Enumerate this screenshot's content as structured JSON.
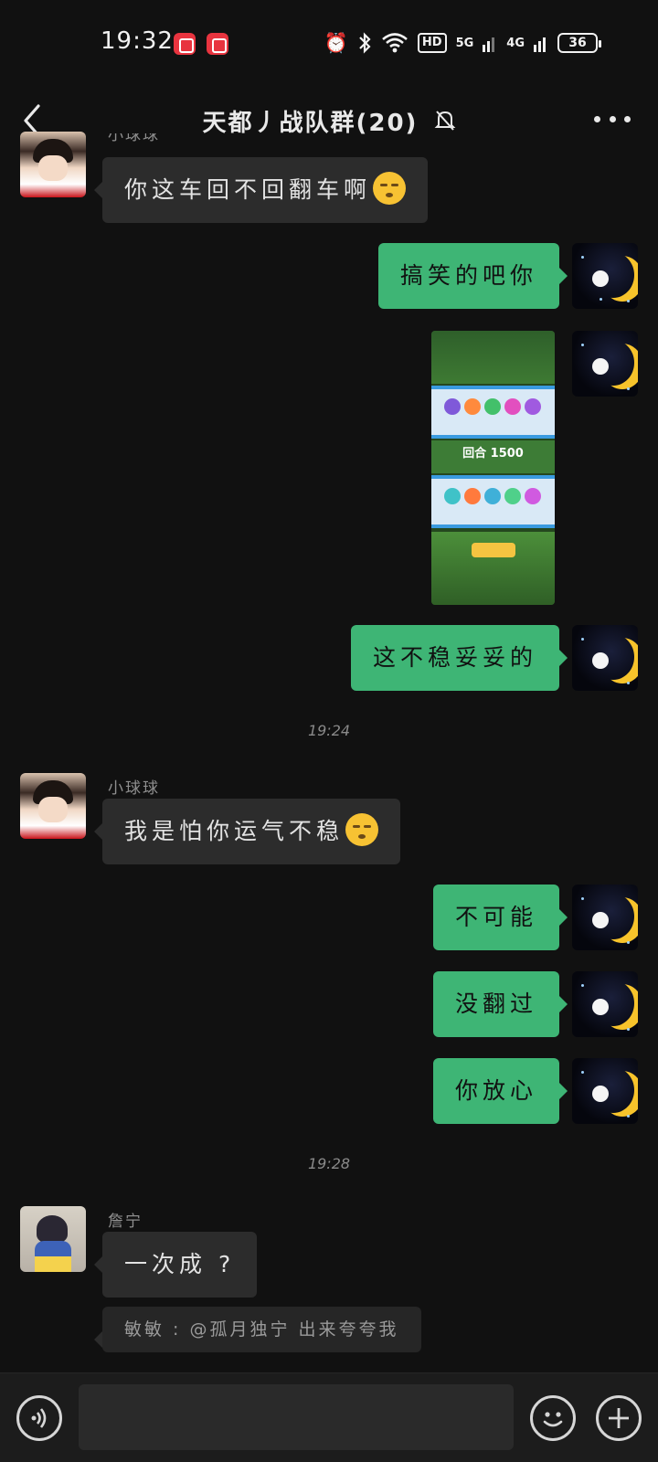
{
  "status_bar": {
    "time": "19:32",
    "network_1": "5G",
    "network_2": "4G",
    "hd": "HD",
    "battery": "36",
    "icons": [
      "app-notification-icon",
      "screen-record-icon",
      "alarm-icon",
      "bluetooth-icon",
      "wifi-icon"
    ]
  },
  "header": {
    "title": "天都丿战队群(20)",
    "icons": [
      "back-icon",
      "mute-bell-icon",
      "more-icon"
    ]
  },
  "messages": [
    {
      "sender": "小球球",
      "text": "你这车回不回翻车啊",
      "direction": "in",
      "emoji": "shushing-face"
    },
    {
      "text": "搞笑的吧你",
      "direction": "out"
    },
    {
      "type": "image",
      "direction": "out",
      "image_text": "回合 1500"
    },
    {
      "text": "这不稳妥妥的",
      "direction": "out"
    },
    {
      "type": "timestamp",
      "text": "19:24"
    },
    {
      "sender": "小球球",
      "text": "我是怕你运气不稳",
      "direction": "in",
      "emoji": "shushing-face"
    },
    {
      "text": "不可能",
      "direction": "out"
    },
    {
      "text": "没翻过",
      "direction": "out"
    },
    {
      "text": "你放心",
      "direction": "out"
    },
    {
      "type": "timestamp",
      "text": "19:28"
    },
    {
      "sender": "詹宁",
      "text": "一次成 ?",
      "direction": "in"
    },
    {
      "type": "quote",
      "text": "敏敏 : @孤月独宁 出来夸夸我"
    }
  ],
  "input_bar": {
    "placeholder": "",
    "icons": [
      "voice-icon",
      "emoji-icon",
      "plus-icon"
    ]
  },
  "colors": {
    "background": "#111111",
    "outgoing_bubble": "#3eb575",
    "incoming_bubble": "#2c2c2c"
  }
}
